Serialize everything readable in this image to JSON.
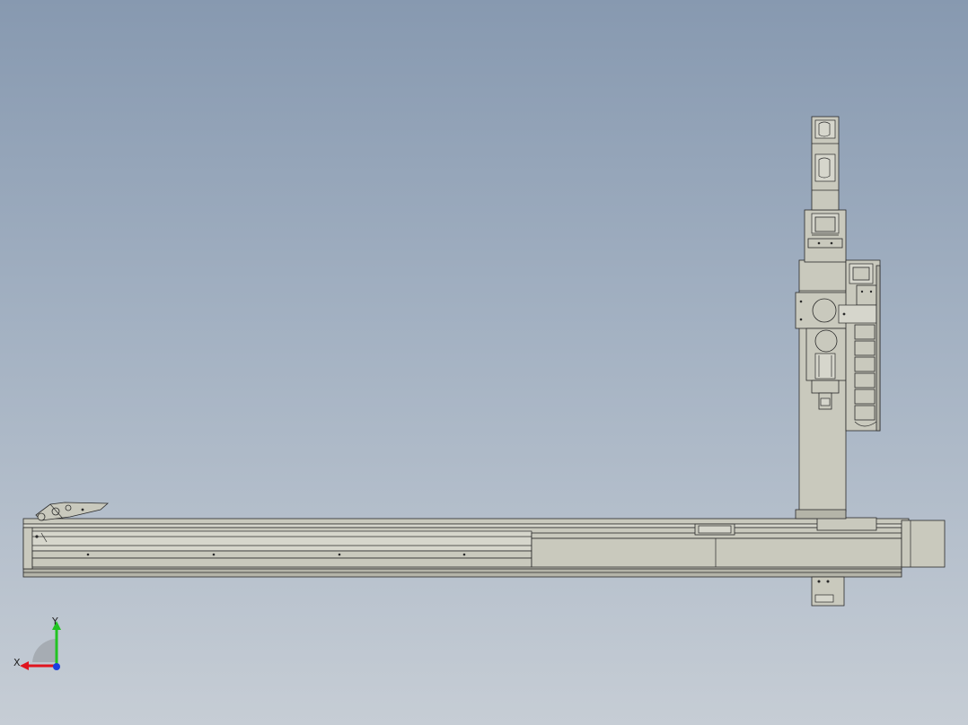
{
  "view": {
    "background_colors": [
      "#8799b0",
      "#c6cdd5"
    ],
    "part_color": "#c9c9bd",
    "edge_color": "#2a2a2a"
  },
  "triad": {
    "x_label": "X",
    "y_label": "Y",
    "x_color": "#e0141e",
    "y_color": "#22c322",
    "z_color": "#1a3ee0"
  },
  "model": {
    "icon": "linear-gantry-robot-model"
  }
}
